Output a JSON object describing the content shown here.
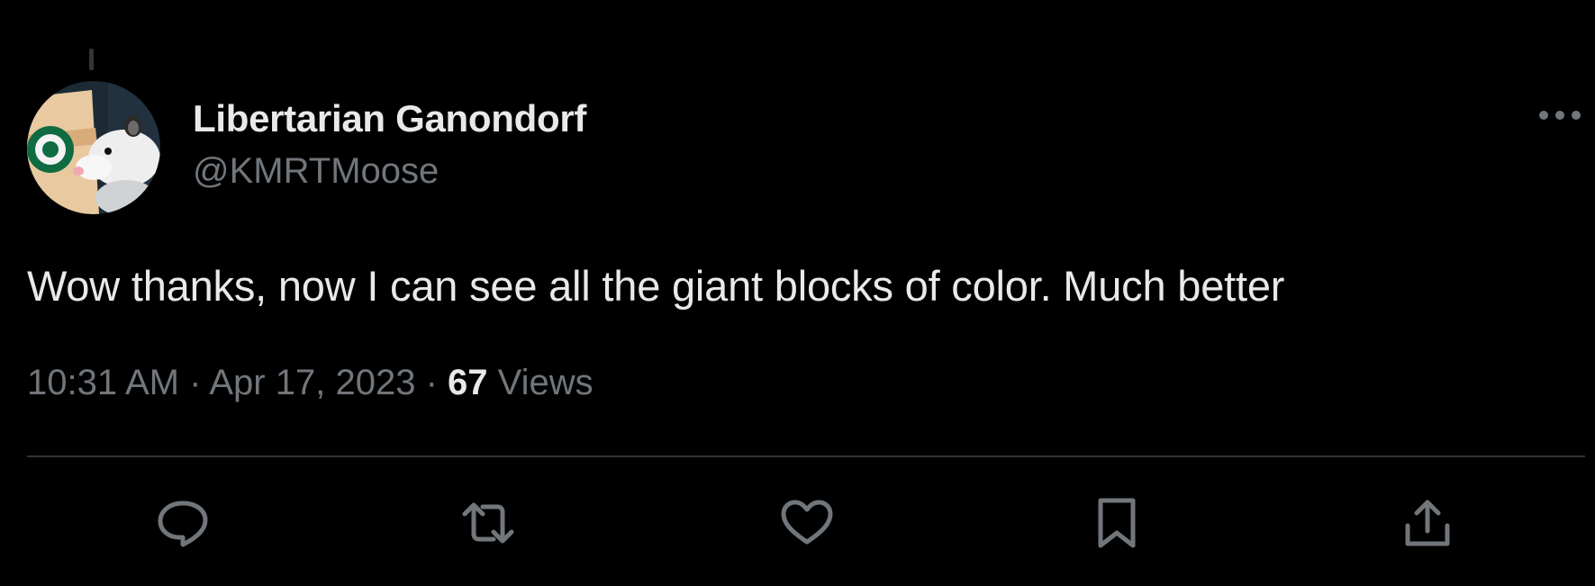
{
  "author": {
    "display_name": "Libertarian Ganondorf",
    "handle": "@KMRTMoose",
    "avatar_icon": "avatar-opossum-coffee-cup"
  },
  "tweet": {
    "text": "Wow thanks, now I can see all the giant blocks of color. Much better"
  },
  "meta": {
    "time": "10:31 AM",
    "separator": "·",
    "date": "Apr 17, 2023",
    "views_count": "67",
    "views_label": "Views"
  },
  "actions": [
    {
      "name": "reply",
      "icon": "reply-icon"
    },
    {
      "name": "retweet",
      "icon": "retweet-icon"
    },
    {
      "name": "like",
      "icon": "heart-icon"
    },
    {
      "name": "bookmark",
      "icon": "bookmark-icon"
    },
    {
      "name": "share",
      "icon": "share-icon"
    }
  ],
  "more_menu_icon": "more-icon",
  "colors": {
    "background": "#000000",
    "primary_text": "#e7e9ea",
    "secondary_text": "#71767b",
    "divider": "#2f3336"
  }
}
